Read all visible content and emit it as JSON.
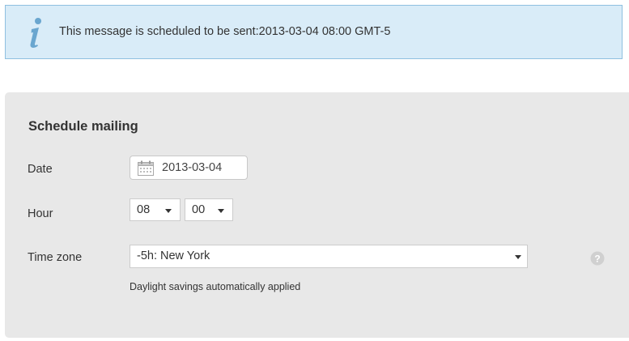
{
  "banner": {
    "icon": "info-icon",
    "message": "This message is scheduled to be sent:2013-03-04 08:00 GMT-5",
    "background": "#d9ecf8",
    "border_color": "#8fc0e0"
  },
  "schedule": {
    "title": "Schedule mailing",
    "date": {
      "label": "Date",
      "value": "2013-03-04",
      "icon": "calendar-icon"
    },
    "hour": {
      "label": "Hour",
      "hour_value": "08",
      "minute_value": "00"
    },
    "timezone": {
      "label": "Time zone",
      "value": "-5h: New York",
      "hint": "Daylight savings automatically applied",
      "help_icon": "help-icon"
    },
    "panel_background": "#e8e8e8"
  }
}
